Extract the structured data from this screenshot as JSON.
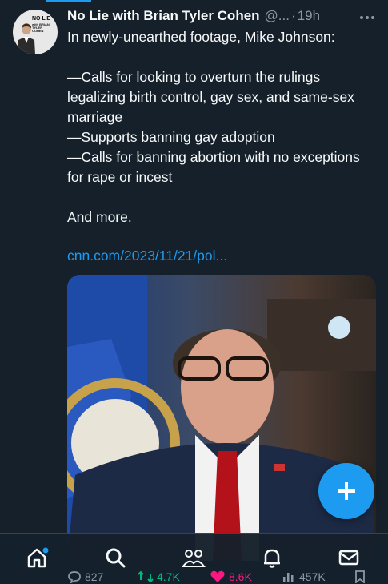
{
  "tweet": {
    "author_name": "No Lie with Brian Tyler Cohen",
    "handle": "@...",
    "separator": "·",
    "time": "19h",
    "avatar_text_line1": "NO LIE",
    "avatar_text_line2": "with BRIAN TYLER COHEN",
    "lines": [
      "In newly-unearthed footage, Mike Johnson:",
      "",
      "—Calls for looking to overturn the rulings legalizing birth control, gay sex, and same-sex marriage",
      "—Supports banning gay adoption",
      "—Calls for banning abortion with no exceptions for rape or incest",
      "",
      "And more."
    ],
    "link": "cnn.com/2023/11/21/pol...",
    "stats": {
      "replies": "827",
      "retweets": "4.7K",
      "likes": "8.6K",
      "views": "457K"
    }
  },
  "colors": {
    "background": "#15202b",
    "accent": "#1d9bf0",
    "secondary_text": "#8b98a5",
    "like": "#f91880",
    "retweet": "#00ba7c"
  },
  "nav": [
    "home-icon",
    "search-icon",
    "communities-icon",
    "notifications-icon",
    "messages-icon"
  ]
}
